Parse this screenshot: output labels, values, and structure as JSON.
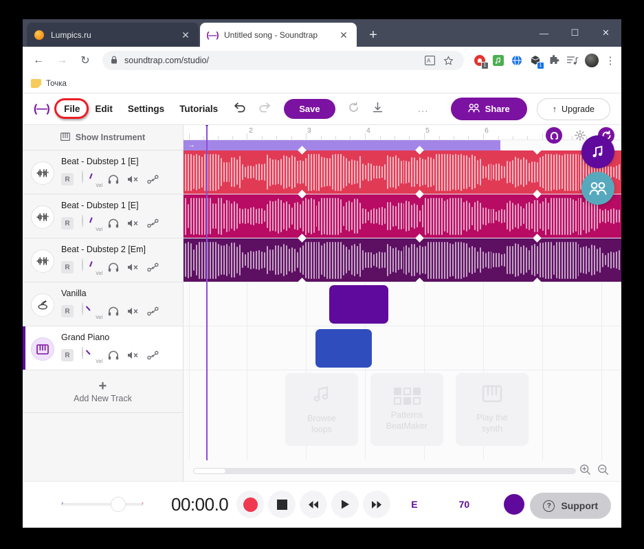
{
  "browser": {
    "tabs": [
      {
        "title": "Lumpics.ru",
        "icon": "orange-circle-favicon",
        "active": false,
        "close": "✕"
      },
      {
        "title": "Untitled song - Soundtrap",
        "icon": "soundtrap-favicon",
        "active": true,
        "close": "✕"
      }
    ],
    "new_tab_label": "+",
    "window_controls": {
      "minimize": "—",
      "maximize": "☐",
      "close": "✕"
    },
    "nav": {
      "back": "←",
      "forward": "→",
      "reload": "↻"
    },
    "address": {
      "lock": "🔒",
      "url": "soundtrap.com/studio/"
    },
    "omnibox_icons": [
      "translate-icon",
      "bookmark-star-icon"
    ],
    "extension_icons": [
      "opera-gx-extension-icon",
      "music-extension-icon",
      "globe-extension-icon",
      "package-extension-icon",
      "puzzle-extension-icon",
      "reading-list-icon"
    ],
    "extension_badges": {
      "first": "1",
      "second": "1"
    },
    "menu_kebab": "⋮",
    "bookmarks": [
      {
        "label": "Точка",
        "icon": "folder-icon"
      }
    ]
  },
  "app": {
    "logo": "(—)",
    "menu": [
      {
        "label": "File",
        "highlighted": true
      },
      {
        "label": "Edit",
        "highlighted": false
      },
      {
        "label": "Settings",
        "highlighted": false
      },
      {
        "label": "Tutorials",
        "highlighted": false
      }
    ],
    "undo_icon": "↶",
    "redo_icon": "↷",
    "save_label": "Save",
    "revert_icon": "↺",
    "download_icon": "↓",
    "overflow_label": "...",
    "share_label": "Share",
    "share_icon": "people-icon",
    "upgrade_label": "Upgrade",
    "upgrade_icon": "↑",
    "show_instrument_label": "Show Instrument",
    "show_instrument_icon": "piano-icon",
    "add_track_label": "Add New Track",
    "add_track_icon": "+",
    "track_control_labels": {
      "record": "R",
      "volume": "Vol",
      "headphones": "headphones-icon",
      "mute": "mute-icon",
      "automation": "automation-icon"
    },
    "tracks": [
      {
        "name": "Beat - Dubstep 1 [E]",
        "icon": "waveform-icon",
        "selected": false,
        "type": "audio",
        "clip_color": "#e13a55",
        "knob_angle": 20
      },
      {
        "name": "Beat - Dubstep 1 [E]",
        "icon": "waveform-icon",
        "selected": false,
        "type": "audio",
        "clip_color": "#b80b63",
        "knob_angle": 20
      },
      {
        "name": "Beat - Dubstep 2 [Em]",
        "icon": "waveform-icon",
        "selected": false,
        "type": "audio",
        "clip_color": "#5d0f62",
        "knob_angle": 20
      },
      {
        "name": "Vanilla",
        "icon": "drum-icon",
        "selected": false,
        "type": "midi",
        "clip_color": "#5f0a9c",
        "knob_angle": -35
      },
      {
        "name": "Grand Piano",
        "icon": "piano-icon",
        "selected": true,
        "type": "midi",
        "clip_color": "#2f4dbd",
        "knob_angle": -35
      }
    ],
    "ruler_marks": [
      "2",
      "3",
      "4",
      "5",
      "6"
    ],
    "loop_region_icon": "→",
    "float_buttons": [
      {
        "name": "magnet-snap-icon",
        "style": "purple",
        "glyph": "∩"
      },
      {
        "name": "gear-icon",
        "style": "plain",
        "glyph": "⚙"
      },
      {
        "name": "loop-icon",
        "style": "purple",
        "glyph": "↻"
      }
    ],
    "fabs": [
      {
        "name": "music-note-fab",
        "glyph": "♫",
        "color": "#5f0a9c"
      },
      {
        "name": "collaborate-fab",
        "glyph": "people-icon",
        "color": "#56a9bd"
      }
    ],
    "promos": [
      {
        "label_line1": "Browse",
        "label_line2": "loops",
        "icon": "music-note-icon"
      },
      {
        "label_line1": "Patterns",
        "label_line2": "BeatMaker",
        "icon": "beat-grid-icon"
      },
      {
        "label_line1": "Play the",
        "label_line2": "synth",
        "icon": "piano-keys-icon"
      }
    ],
    "zoom_in_icon": "zoom-in-icon",
    "zoom_out_icon": "zoom-out-icon"
  },
  "transport": {
    "master_min": "♪",
    "master_max": "♪",
    "timecode": "00:00.0",
    "record_label": "record-button",
    "stop_label": "stop-button",
    "rewind_icon": "❮❮",
    "play_icon": "▶",
    "forward_icon": "❯❯",
    "key": "E",
    "bpm": "70",
    "metronome_icon": "metronome-icon"
  },
  "support": {
    "label": "Support",
    "icon": "question-mark-icon"
  }
}
